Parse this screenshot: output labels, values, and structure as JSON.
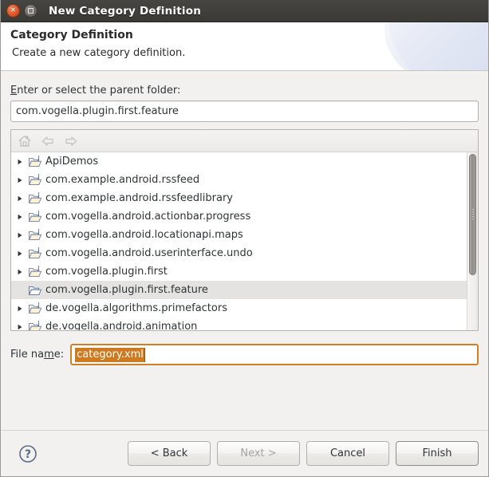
{
  "window": {
    "title": "New Category Definition",
    "close_icon": "close-icon",
    "maximize_icon": "maximize-icon"
  },
  "banner": {
    "title": "Category Definition",
    "subtitle": "Create a new category definition."
  },
  "parent_folder": {
    "label_prefix": "",
    "label_mnemonic": "E",
    "label_suffix": "nter or select the parent folder:",
    "value": "com.vogella.plugin.first.feature"
  },
  "tree_toolbar": {
    "items": [
      {
        "name": "home-icon",
        "enabled": false
      },
      {
        "name": "back-icon",
        "enabled": false
      },
      {
        "name": "forward-icon",
        "enabled": false
      }
    ]
  },
  "tree": {
    "rows": [
      {
        "label": "ApiDemos",
        "expandable": true,
        "selected": false,
        "java": true
      },
      {
        "label": "com.example.android.rssfeed",
        "expandable": true,
        "selected": false,
        "java": true
      },
      {
        "label": "com.example.android.rssfeedlibrary",
        "expandable": true,
        "selected": false,
        "java": true
      },
      {
        "label": "com.vogella.android.actionbar.progress",
        "expandable": true,
        "selected": false,
        "java": true
      },
      {
        "label": "com.vogella.android.locationapi.maps",
        "expandable": true,
        "selected": false,
        "java": true
      },
      {
        "label": "com.vogella.android.userinterface.undo",
        "expandable": true,
        "selected": false,
        "java": true
      },
      {
        "label": "com.vogella.plugin.first",
        "expandable": true,
        "selected": false,
        "java": true
      },
      {
        "label": "com.vogella.plugin.first.feature",
        "expandable": false,
        "selected": true,
        "java": false
      },
      {
        "label": "de.vogella.algorithms.primefactors",
        "expandable": true,
        "selected": false,
        "java": true
      },
      {
        "label": "de.vogella.android.animation",
        "expandable": true,
        "selected": false,
        "java": true
      }
    ],
    "scrollbar": {
      "orientation": "vertical",
      "thumb_position": "top"
    }
  },
  "filename": {
    "label_prefix": "File na",
    "label_mnemonic": "m",
    "label_suffix": "e:",
    "value": "category.xml",
    "selected": true
  },
  "buttons": {
    "help": "?",
    "back": "< Back",
    "next": "Next >",
    "cancel": "Cancel",
    "finish": "Finish"
  },
  "colors": {
    "titlebar": "#3b3a36",
    "close_button": "#e2562a",
    "focus_border": "#d08023",
    "selection_highlight": "#cd7a20",
    "row_selection": "#e4e3e1",
    "folder_outline": "#6a7fa8"
  }
}
